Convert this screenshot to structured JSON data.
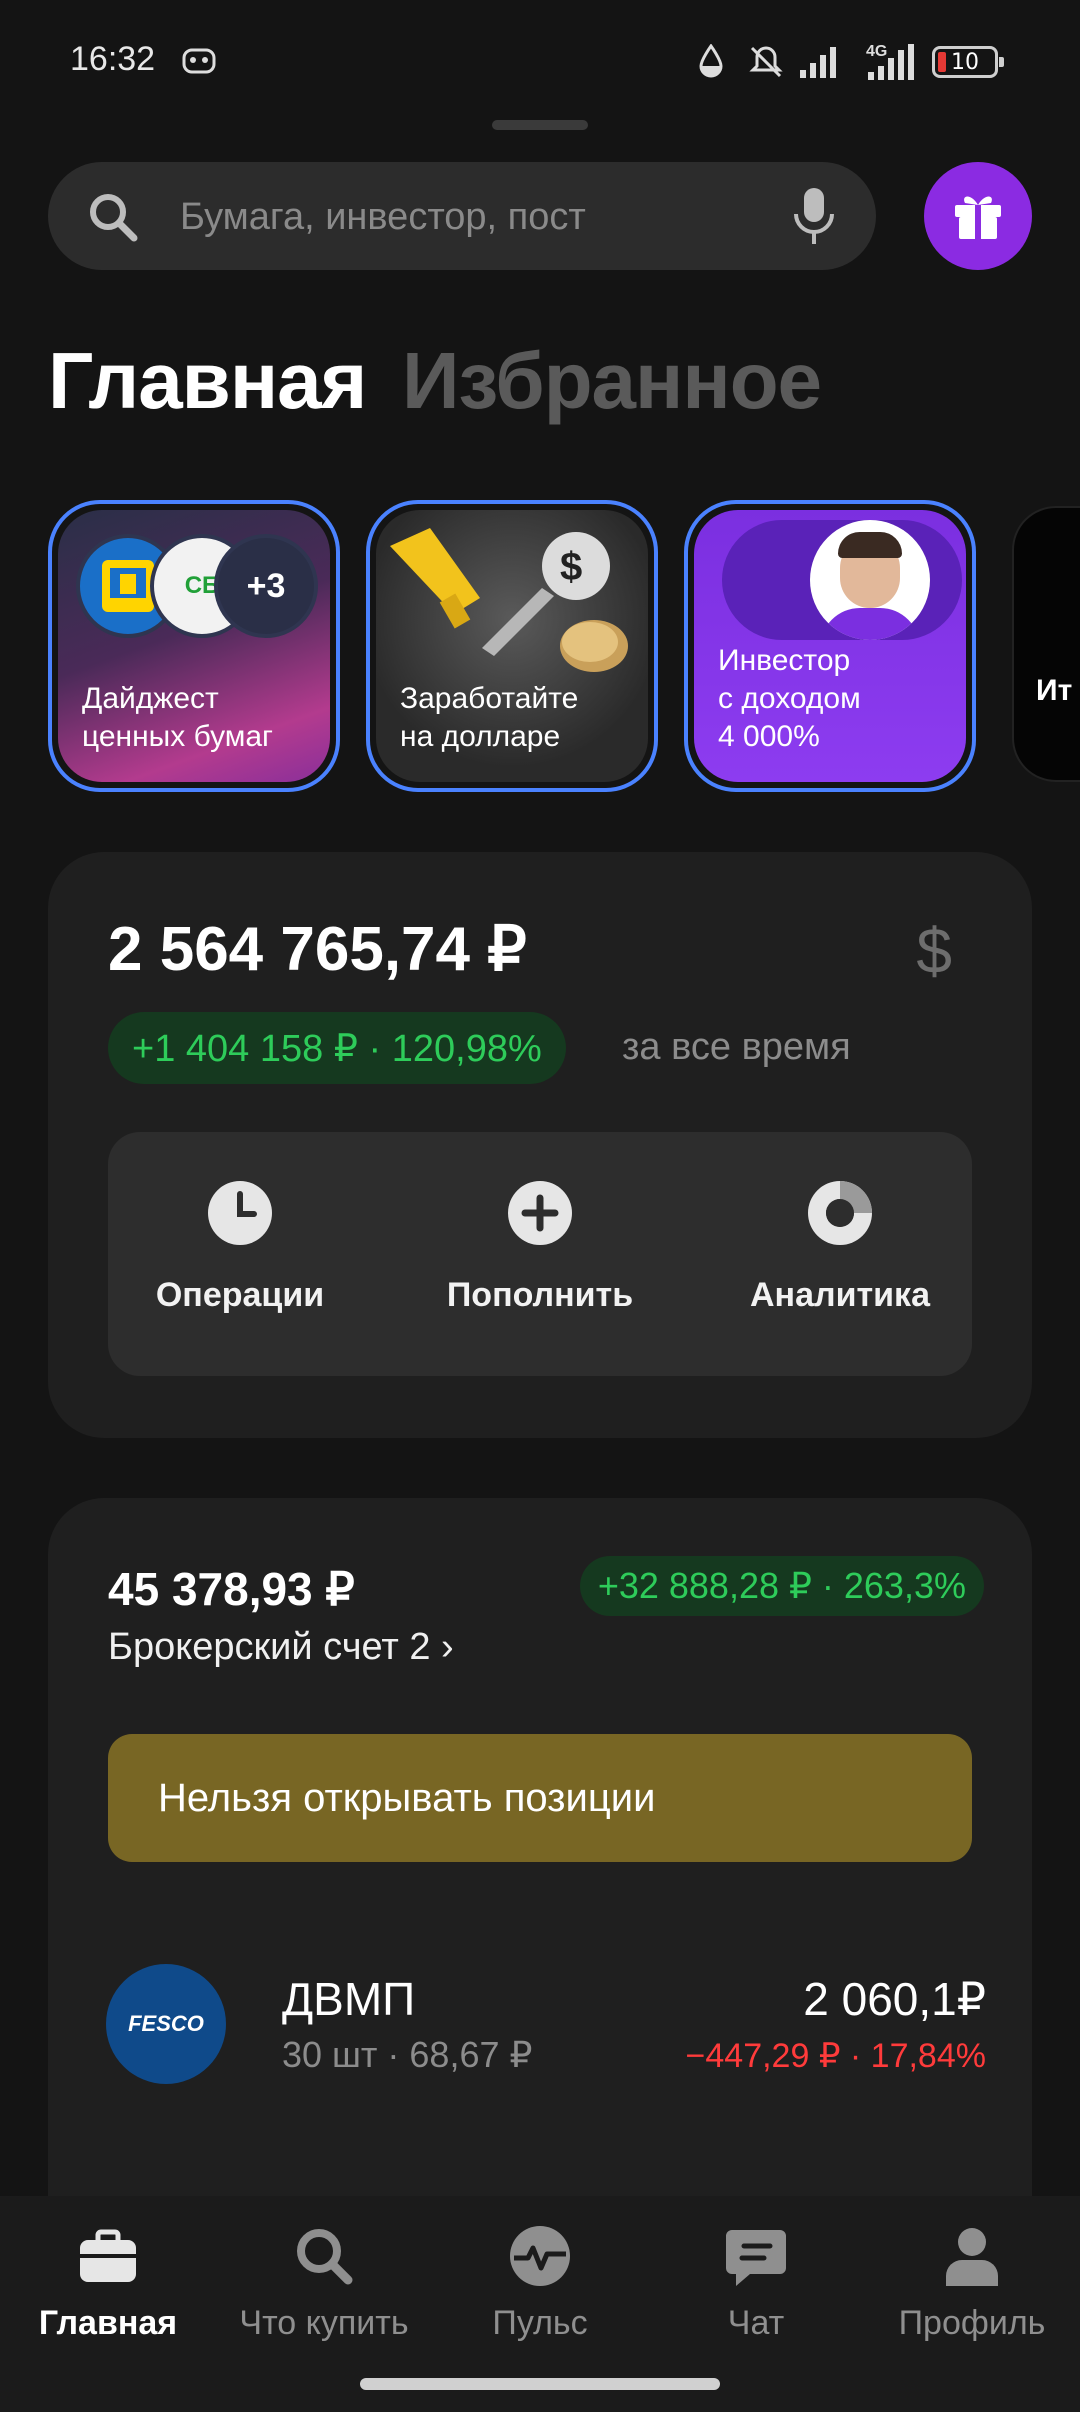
{
  "status_bar": {
    "time": "16:32",
    "network": "4G",
    "battery": "10"
  },
  "search": {
    "placeholder": "Бумага, инвестор, пост"
  },
  "tabs": [
    {
      "label": "Главная"
    },
    {
      "label": "Избранное"
    }
  ],
  "stories": [
    {
      "title": "Дайджест\nценных бумаг",
      "more_count": "+3",
      "logo_text": "СБ"
    },
    {
      "title": "Заработайте\nна долларе"
    },
    {
      "title": "Инвестор\nс доходом\n4 000%"
    },
    {
      "title": "Ит"
    }
  ],
  "portfolio": {
    "total": "2 564 765,74 ₽",
    "currency_symbol": "$",
    "gain": "+1 404 158 ₽ · 120,98%",
    "gain_period": "за все время",
    "actions": [
      {
        "label": "Операции"
      },
      {
        "label": "Пополнить"
      },
      {
        "label": "Аналитика"
      }
    ]
  },
  "broker": {
    "value": "45 378,93 ₽",
    "gain": "+32 888,28 ₽ · 263,3%",
    "name": "Брокерский счет 2 ›",
    "warning": "Нельзя открывать позиции",
    "positions": [
      {
        "logo_text": "FESCO",
        "name": "ДВМП",
        "qty": "30 шт · 68,67 ₽",
        "value": "2 060,1₽",
        "change": "−447,29 ₽ · 17,84%"
      }
    ]
  },
  "bottom_nav": [
    {
      "label": "Главная",
      "icon": "briefcase-icon",
      "active": true
    },
    {
      "label": "Что купить",
      "icon": "search-icon"
    },
    {
      "label": "Пульс",
      "icon": "pulse-icon"
    },
    {
      "label": "Чат",
      "icon": "chat-icon"
    },
    {
      "label": "Профиль",
      "icon": "profile-icon"
    }
  ],
  "colors": {
    "accent_purple": "#8b2be2",
    "gain_green": "#2ecc5a",
    "loss_red": "#ff3b3b",
    "warning_bg": "#786624",
    "story_border": "#4a82ff"
  }
}
